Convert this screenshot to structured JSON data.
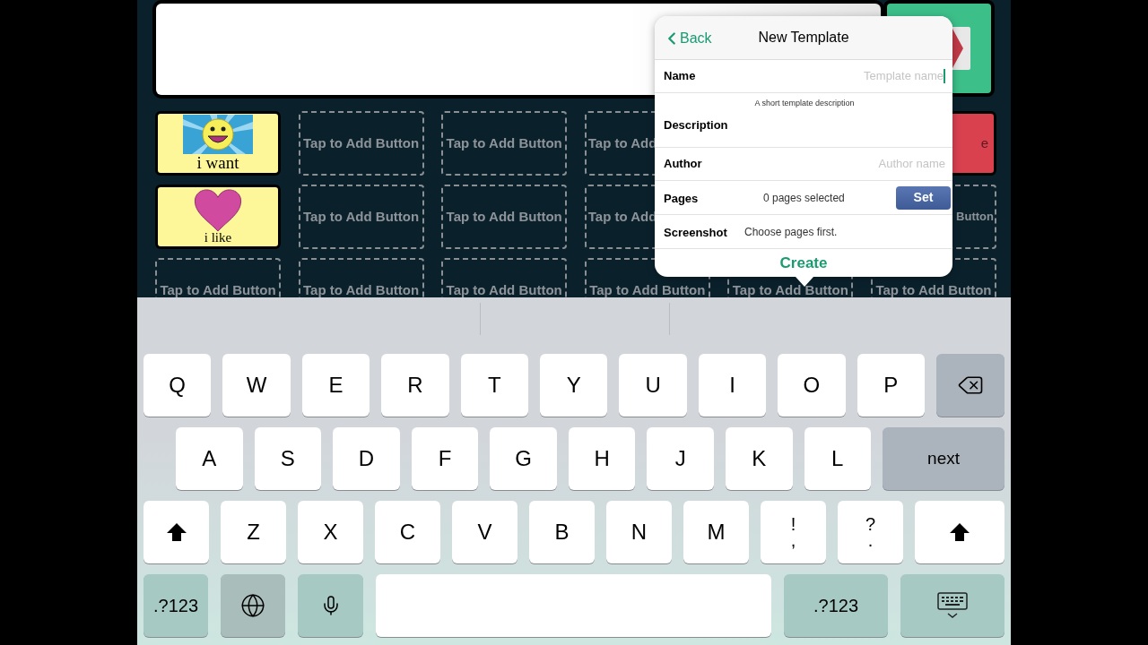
{
  "grid": {
    "rows": [
      {
        "cells": [
          {
            "kind": "symbol",
            "label": "i want"
          },
          {
            "kind": "empty",
            "label": "Tap to Add Button"
          },
          {
            "kind": "empty",
            "label": "Tap to Add Button"
          },
          {
            "kind": "empty",
            "label": "Tap to Add",
            "covered_right": true
          },
          {
            "kind": "covered"
          },
          {
            "kind": "action",
            "label": "e",
            "covered_left": true
          }
        ]
      },
      {
        "cells": [
          {
            "kind": "symbol",
            "label": "i like"
          },
          {
            "kind": "empty",
            "label": "Tap to Add Button"
          },
          {
            "kind": "empty",
            "label": "Tap to Add Button"
          },
          {
            "kind": "empty",
            "label": "Tap to Add",
            "covered_right": true
          },
          {
            "kind": "covered"
          },
          {
            "kind": "empty",
            "label": "Button",
            "covered_left": true
          }
        ]
      },
      {
        "cells": [
          {
            "kind": "empty",
            "label": "Tap to Add Button"
          },
          {
            "kind": "empty",
            "label": "Tap to Add Button"
          },
          {
            "kind": "empty",
            "label": "Tap to Add Button"
          },
          {
            "kind": "empty",
            "label": "Tap to Add Button"
          },
          {
            "kind": "empty",
            "label": "Tap to Add Button"
          },
          {
            "kind": "empty",
            "label": "Tap to Add Button"
          }
        ]
      }
    ]
  },
  "popover": {
    "back": "Back",
    "title": "New Template",
    "rows": [
      {
        "kind": "input",
        "label": "Name",
        "placeholder": "Template name",
        "focused": true
      },
      {
        "kind": "textarea",
        "label": "Description",
        "placeholder": "A short template description"
      },
      {
        "kind": "input",
        "label": "Author",
        "placeholder": "Author name",
        "focused": false
      },
      {
        "kind": "set",
        "label": "Pages",
        "value": "0 pages selected",
        "button": "Set"
      },
      {
        "kind": "text",
        "label": "Screenshot",
        "value": "Choose pages first."
      }
    ],
    "action": "Create"
  },
  "keyboard": {
    "rows": [
      {
        "keys": [
          {
            "kind": "letter",
            "label": "Q"
          },
          {
            "kind": "letter",
            "label": "W"
          },
          {
            "kind": "letter",
            "label": "E"
          },
          {
            "kind": "letter",
            "label": "R"
          },
          {
            "kind": "letter",
            "label": "T"
          },
          {
            "kind": "letter",
            "label": "Y"
          },
          {
            "kind": "letter",
            "label": "U"
          },
          {
            "kind": "letter",
            "label": "I"
          },
          {
            "kind": "letter",
            "label": "O"
          },
          {
            "kind": "letter",
            "label": "P"
          },
          {
            "kind": "backspace"
          }
        ]
      },
      {
        "keys": [
          {
            "kind": "letter",
            "label": "A"
          },
          {
            "kind": "letter",
            "label": "S"
          },
          {
            "kind": "letter",
            "label": "D"
          },
          {
            "kind": "letter",
            "label": "F"
          },
          {
            "kind": "letter",
            "label": "G"
          },
          {
            "kind": "letter",
            "label": "H"
          },
          {
            "kind": "letter",
            "label": "J"
          },
          {
            "kind": "letter",
            "label": "K"
          },
          {
            "kind": "letter",
            "label": "L"
          },
          {
            "kind": "next",
            "label": "next"
          }
        ]
      },
      {
        "keys": [
          {
            "kind": "shift"
          },
          {
            "kind": "letter",
            "label": "Z"
          },
          {
            "kind": "letter",
            "label": "X"
          },
          {
            "kind": "letter",
            "label": "C"
          },
          {
            "kind": "letter",
            "label": "V"
          },
          {
            "kind": "letter",
            "label": "B"
          },
          {
            "kind": "letter",
            "label": "N"
          },
          {
            "kind": "letter",
            "label": "M"
          },
          {
            "kind": "dual",
            "top": "!",
            "bottom": ","
          },
          {
            "kind": "dual",
            "top": "?",
            "bottom": "."
          },
          {
            "kind": "shift"
          }
        ]
      },
      {
        "keys": [
          {
            "kind": "mode",
            "label": ".?123"
          },
          {
            "kind": "globe"
          },
          {
            "kind": "mic"
          },
          {
            "kind": "space"
          },
          {
            "kind": "mode",
            "label": ".?123"
          },
          {
            "kind": "dismiss"
          }
        ]
      }
    ]
  }
}
